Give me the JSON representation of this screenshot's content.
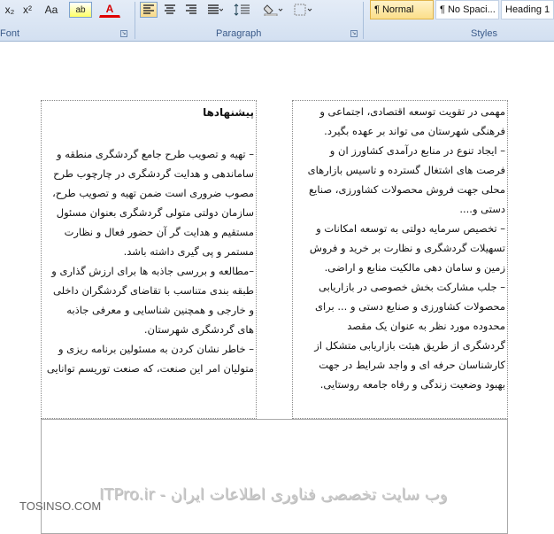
{
  "ribbon": {
    "font_group_label": "Font",
    "paragraph_group_label": "Paragraph",
    "styles_group_label": "Styles",
    "font_buttons": [
      "x₂",
      "x²",
      "Aa",
      "ab",
      "A"
    ],
    "styles": [
      "¶ Normal",
      "¶ No Spaci...",
      "Heading 1"
    ]
  },
  "document": {
    "left_column": {
      "heading": "پیشنهادها",
      "lines": [
        "– تهیه و تصویب طرح جامع گردشگری منطقه و",
        "ساماندهی و هدایت گردشگری در چارچوب طرح",
        "مصوب ضروری است ضمن تهیه و تصویب طرح،",
        "سازمان دولتی متولی گردشگری بعنوان مسئول",
        "مستقیم و هدایت گر آن حضور فعال و نظارت",
        "مستمر و پی گیری داشته باشد.",
        "–مطالعه و بررسی جاذبه ها برای ارزش گذاری و",
        "طبقه بندی متناسب با تقاضای گردشگران داخلی",
        "و خارجی و همچنین شناسایی و معرفی جاذبه",
        "های گردشگری شهرستان.",
        "– خاطر نشان کردن به مسئولین برنامه ریزی و",
        "متولیان امر این صنعت، که صنعت توریسم توانایی"
      ]
    },
    "right_column": {
      "lines": [
        "مهمی در تقویت توسعه اقتصادی، اجتماعی و",
        "فرهنگی شهرستان می تواند بر عهده بگیرد.",
        "–  ایجاد تنوع در منابع درآمدی کشاورز ان و",
        "فرصت های اشتغال گسترده و تاسیس بازارهای",
        "محلی جهت فروش محصولات کشاورزی، صنایع",
        "دستی و....",
        "–  تخصیص سرمایه دولتی به توسعه امکانات و",
        "تسهیلات گردشگری و نظارت بر خرید و فروش",
        "زمین و سامان دهی مالکیت منابع  و اراضی.",
        "– جلب مشارکت بخش خصوصی در بازاریابی",
        "محصولات کشاورزی و صنایع دستی و ...  برای",
        "محدوده  مورد نظر به عنوان یک مقصد",
        "گردشگری از طریق هیئت بازاریابی متشکل از",
        "کارشناسان حرفه ای و واجد شرایط در جهت",
        "بهبود وضعیت زندگی و رفاه جامعه روستایی."
      ]
    }
  },
  "watermark": {
    "text": "ITPro.ir - وب سایت تخصصی فناوری اطلاعات ایران",
    "site": "TOSINSO.COM"
  }
}
